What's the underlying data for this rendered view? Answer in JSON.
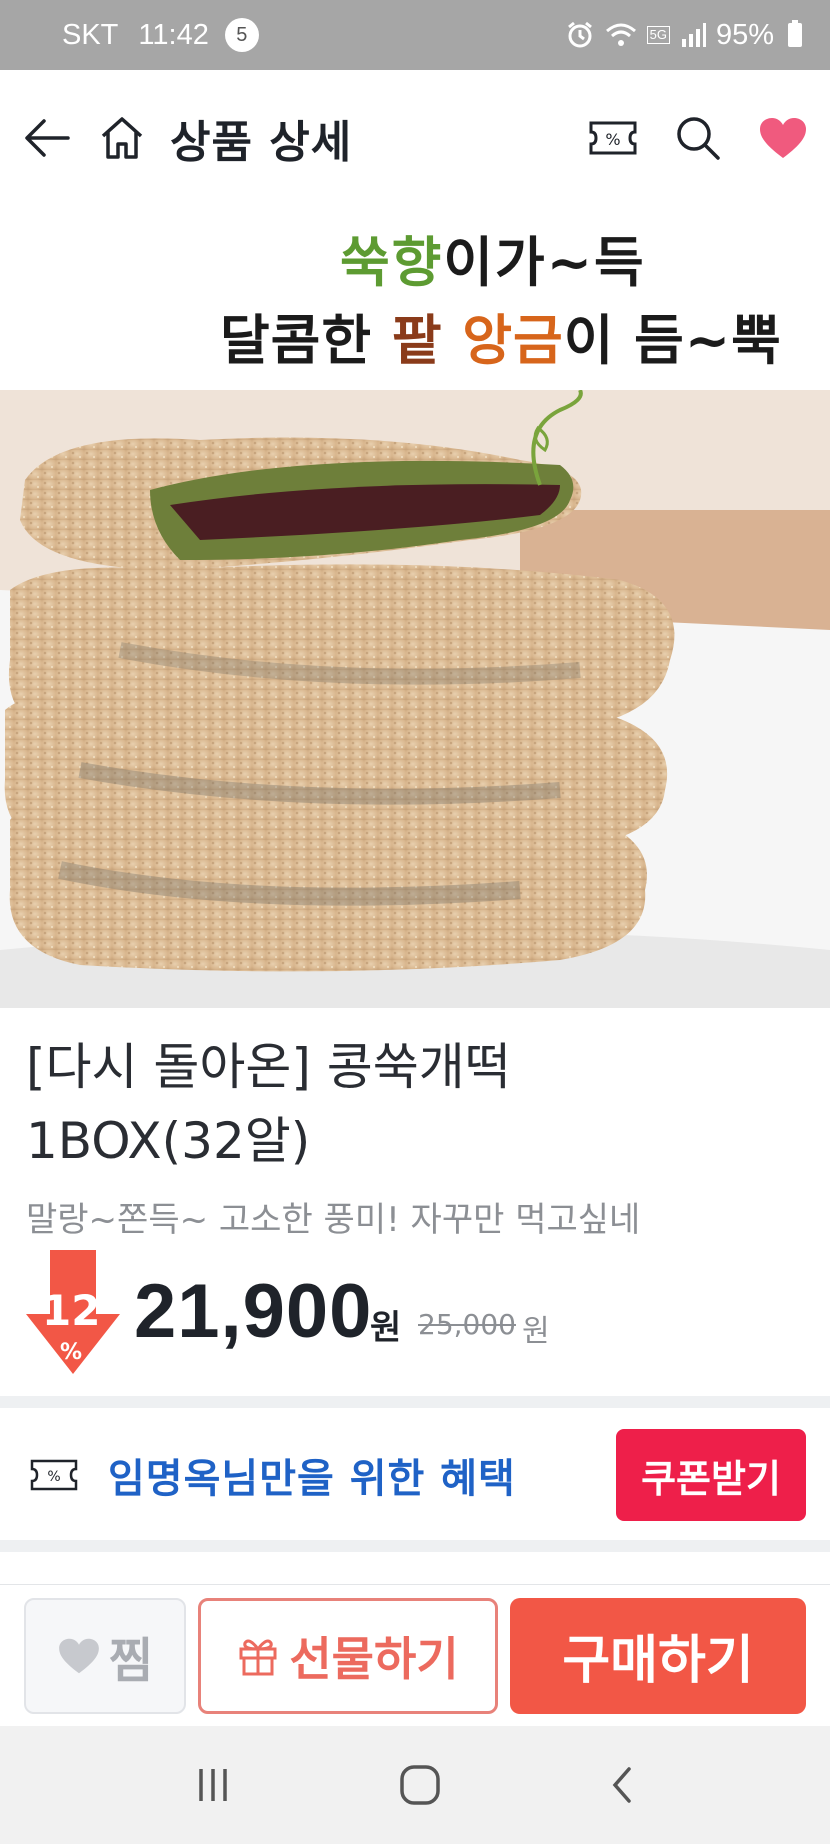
{
  "status_bar": {
    "carrier": "SKT",
    "time": "11:42",
    "notification_count": "5",
    "network": "5G",
    "battery": "95%"
  },
  "header": {
    "title": "상품 상세",
    "icons": [
      "back-arrow-icon",
      "home-icon",
      "coupon-icon",
      "search-icon",
      "heart-icon"
    ]
  },
  "hero": {
    "slogan_line1": [
      "쑥향",
      "이가~득"
    ],
    "slogan_line2": [
      "달콤한 ",
      "팥",
      " 앙금",
      "이 듬~뿍"
    ]
  },
  "product": {
    "title_line1": "[다시 돌아온] 콩쑥개떡",
    "title_line2": "1BOX(32알)",
    "subtitle": "말랑~쫀득~ 고소한 풍미! 자꾸만 먹고싶네",
    "discount_rate": "12",
    "discount_symbol": "%",
    "price": "21,900",
    "price_unit": "원",
    "original_price": "25,000",
    "original_unit": "원"
  },
  "coupon": {
    "benefit_text": "임명옥님만을 위한 혜택",
    "button_label": "쿠폰받기"
  },
  "actions": {
    "wish_label": "찜",
    "gift_label": "선물하기",
    "buy_label": "구매하기"
  },
  "colors": {
    "accent_red": "#ee1f4a",
    "buy_red": "#f25746",
    "coupon_blue": "#1f62c6",
    "heart_pink": "#f05a7e"
  }
}
